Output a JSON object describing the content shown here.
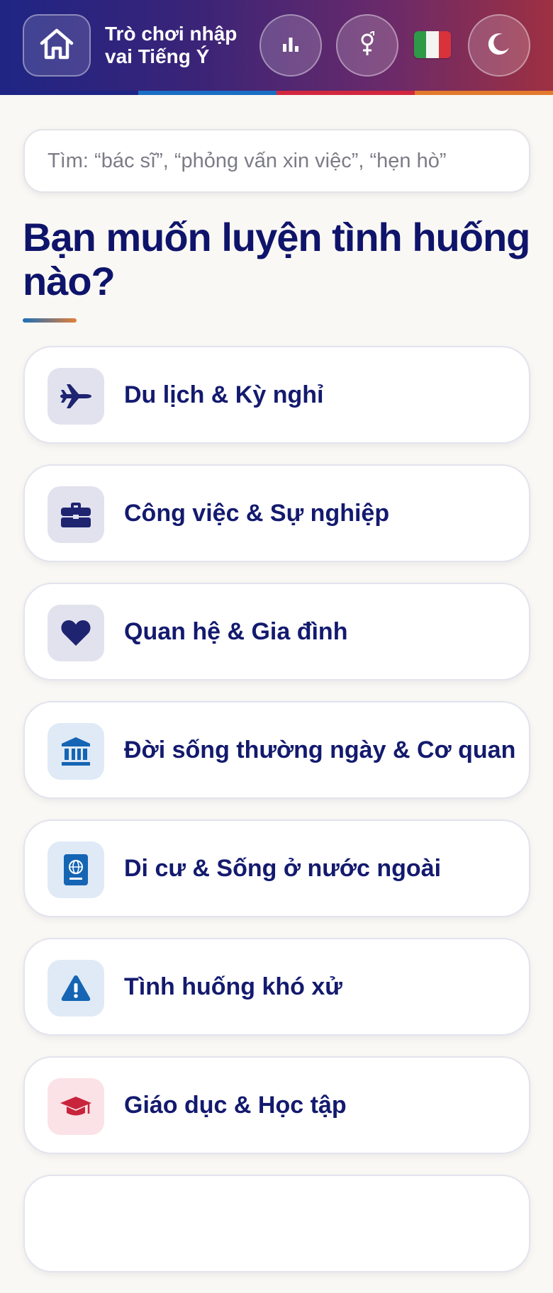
{
  "header": {
    "title": "Trò chơi nhập vai Tiếng Ý",
    "home_icon": "home-icon",
    "stats_icon": "bar-chart-icon",
    "gender_icon": "gender-icon",
    "language_flag": "italian-flag",
    "theme_icon": "moon-icon",
    "stripe_colors": [
      "#1f2584",
      "#1a6fc4",
      "#d2283f",
      "#e27a2c"
    ]
  },
  "search": {
    "placeholder": "Tìm: “bác sĩ”, “phỏng vấn xin việc”, “hẹn hò”"
  },
  "main": {
    "heading": "Bạn muốn luyện tình huống nào?",
    "categories": [
      {
        "label": "Du lịch & Kỳ nghỉ",
        "icon": "airplane-icon",
        "icon_bg": "#e2e2ef",
        "icon_color": "#1e2470"
      },
      {
        "label": "Công việc & Sự nghiệp",
        "icon": "briefcase-icon",
        "icon_bg": "#e2e2ef",
        "icon_color": "#1e2470"
      },
      {
        "label": "Quan hệ & Gia đình",
        "icon": "heart-icon",
        "icon_bg": "#e2e2ef",
        "icon_color": "#1e2470"
      },
      {
        "label": "Đời sống thường ngày & Cơ quan",
        "icon": "bank-icon",
        "icon_bg": "#dfeaf6",
        "icon_color": "#1565b4"
      },
      {
        "label": "Di cư & Sống ở nước ngoài",
        "icon": "passport-icon",
        "icon_bg": "#dfeaf6",
        "icon_color": "#1565b4"
      },
      {
        "label": "Tình huống khó xử",
        "icon": "warning-icon",
        "icon_bg": "#dfeaf6",
        "icon_color": "#1565b4"
      },
      {
        "label": "Giáo dục & Học tập",
        "icon": "graduation-cap-icon",
        "icon_bg": "#fbe2e6",
        "icon_color": "#c8243c"
      },
      {
        "label": "",
        "icon": "",
        "icon_bg": "#ffffff",
        "icon_color": "#ffffff"
      }
    ]
  }
}
